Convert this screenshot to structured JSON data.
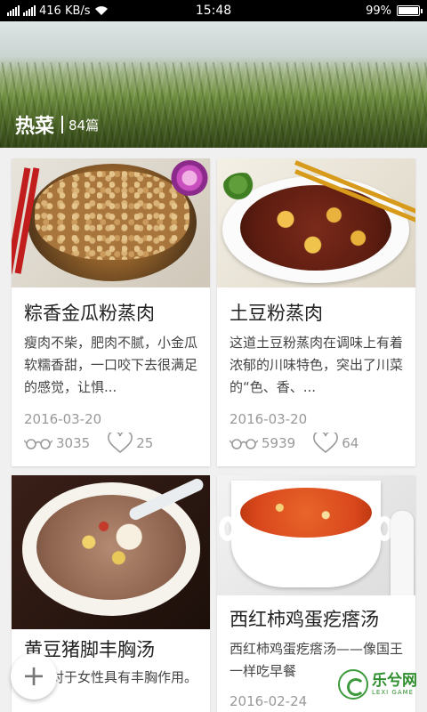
{
  "status_bar": {
    "network": "416 KB/s",
    "time": "15:48",
    "battery": "99%",
    "battery_level": 0.99
  },
  "header": {
    "title": "热菜",
    "count": "84篇"
  },
  "recipes": [
    {
      "title": "粽香金瓜粉蒸肉",
      "description": "瘦肉不柴，肥肉不腻，小金瓜软糯香甜，一口咬下去很满足的感觉，让惧...",
      "date": "2016-03-20",
      "views": "3035",
      "likes": "25"
    },
    {
      "title": "土豆粉蒸肉",
      "description": "这道土豆粉蒸肉在调味上有着浓郁的川味特色，突出了川菜的“色、香、...",
      "date": "2016-03-20",
      "views": "5939",
      "likes": "64"
    },
    {
      "title": "黄豆猪脚丰胸汤",
      "description": "猪蹄对于女性具有丰胸作用。",
      "date": "",
      "views": "",
      "likes": ""
    },
    {
      "title": "西红柿鸡蛋疙瘩汤",
      "description": "西红柿鸡蛋疙瘩汤——像国王一样吃早餐",
      "date": "2016-02-24",
      "views": "",
      "likes": ""
    }
  ],
  "fab": {
    "label": "+"
  },
  "watermark": {
    "cn": "乐兮网",
    "en": "LEXI GAME"
  },
  "icons": {
    "views": "glasses-icon",
    "likes": "heart-icon",
    "wifi": "wifi-icon",
    "signal": "signal-icon"
  }
}
